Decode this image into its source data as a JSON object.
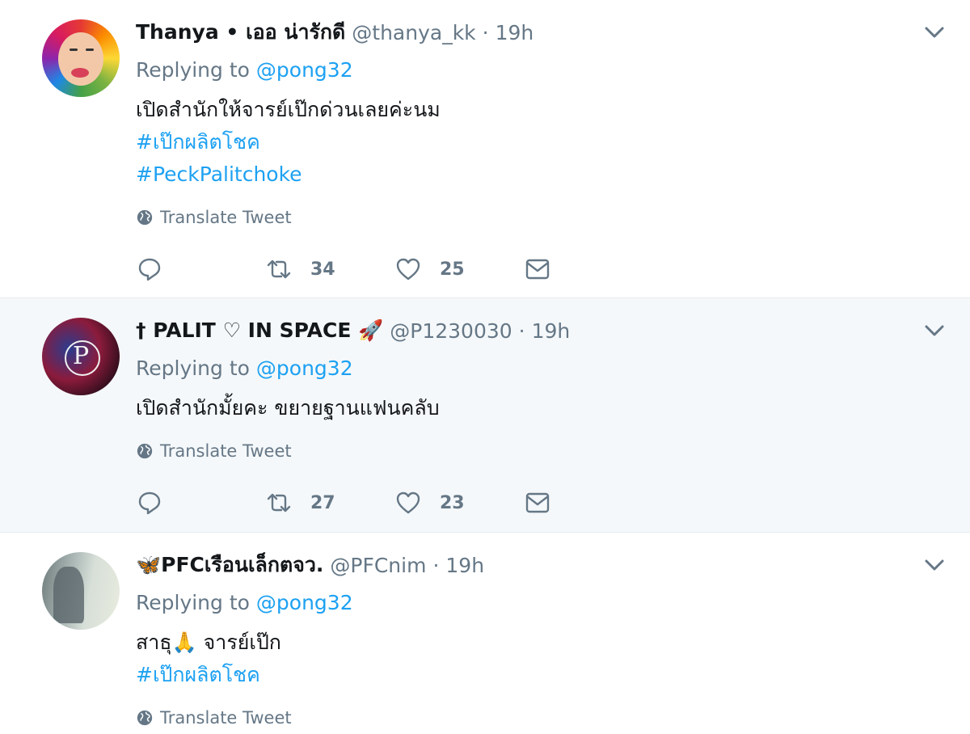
{
  "tweets": [
    {
      "display_name": "Thanya • เออ น่ารักดี",
      "handle": "@thanya_kk",
      "time": "19h",
      "replying_prefix": "Replying to",
      "replying_to": "@pong32",
      "lines": [
        "เปิดสำนักให้จารย์เป๊กด่วนเลยค่ะนม"
      ],
      "hashtags": [
        "#เป๊กผลิตโชค",
        "#PeckPalitchoke"
      ],
      "translate_label": "Translate Tweet",
      "retweets": "34",
      "likes": "25"
    },
    {
      "display_name": "† PALIT ♡ IN SPACE 🚀",
      "handle": "@P1230030",
      "time": "19h",
      "replying_prefix": "Replying to",
      "replying_to": "@pong32",
      "lines": [
        "เปิดสำนักมั้ยคะ ขยายฐานแฟนคลับ"
      ],
      "hashtags": [],
      "translate_label": "Translate Tweet",
      "retweets": "27",
      "likes": "23"
    },
    {
      "display_name": "🦋PFCเรือนเล็กตจว.",
      "handle": "@PFCnim",
      "time": "19h",
      "replying_prefix": "Replying to",
      "replying_to": "@pong32",
      "lines": [
        "สาธุ🙏 จารย์เป๊ก"
      ],
      "hashtags": [
        "#เป๊กผลิตโชค"
      ],
      "translate_label": "Translate Tweet"
    }
  ],
  "icons": [
    "chevron-down-icon",
    "globe-icon",
    "reply-icon",
    "retweet-icon",
    "like-icon",
    "message-icon"
  ],
  "colors": {
    "link": "#1da1f2",
    "secondary_text": "#657786",
    "highlight_bg": "#f5f8fa"
  }
}
